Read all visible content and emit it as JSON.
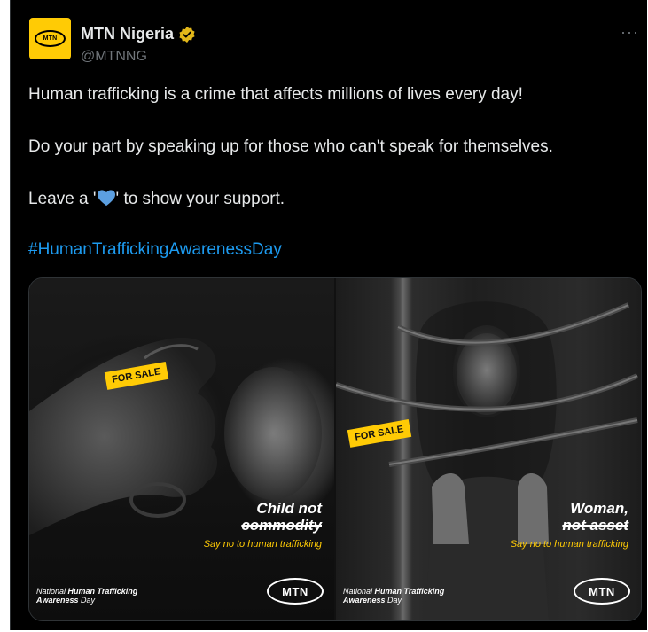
{
  "tweet": {
    "author": {
      "name": "MTN Nigeria",
      "handle": "@MTNNG",
      "avatar_text": "MTN",
      "verified_icon": "gold-checkmark-badge",
      "verified_color": "#e2b719"
    },
    "more_label": "···",
    "paragraphs": {
      "p1": "Human trafficking is a crime that affects millions of lives every day!",
      "p2": "Do your part by speaking up for those who can't speak for themselves.",
      "p3_before": "Leave a '",
      "p3_after": "' to show your support.",
      "heart_icon": "blue-heart-emoji"
    },
    "hashtag": "#HumanTraffickingAwarenessDay"
  },
  "media": {
    "left": {
      "tag": "FOR SALE",
      "headline_line1": "Child not",
      "headline_line2": "commodity",
      "tagline": "Say no to human trafficking",
      "footer_prefix": "National ",
      "footer_bold": "Human Trafficking",
      "footer_line2_bold": "Awareness",
      "footer_line2_rest": " Day",
      "logo": "MTN"
    },
    "right": {
      "tag": "FOR SALE",
      "headline_line1": "Woman,",
      "headline_line2": "not asset",
      "tagline": "Say no to human trafficking",
      "footer_prefix": "National ",
      "footer_bold": "Human Trafficking",
      "footer_line2_bold": "Awareness",
      "footer_line2_rest": " Day",
      "logo": "MTN"
    }
  },
  "colors": {
    "background": "#000000",
    "text": "#e7e9ea",
    "secondary": "#71767b",
    "link": "#1d9bf0",
    "mtn_yellow": "#ffcb05"
  }
}
